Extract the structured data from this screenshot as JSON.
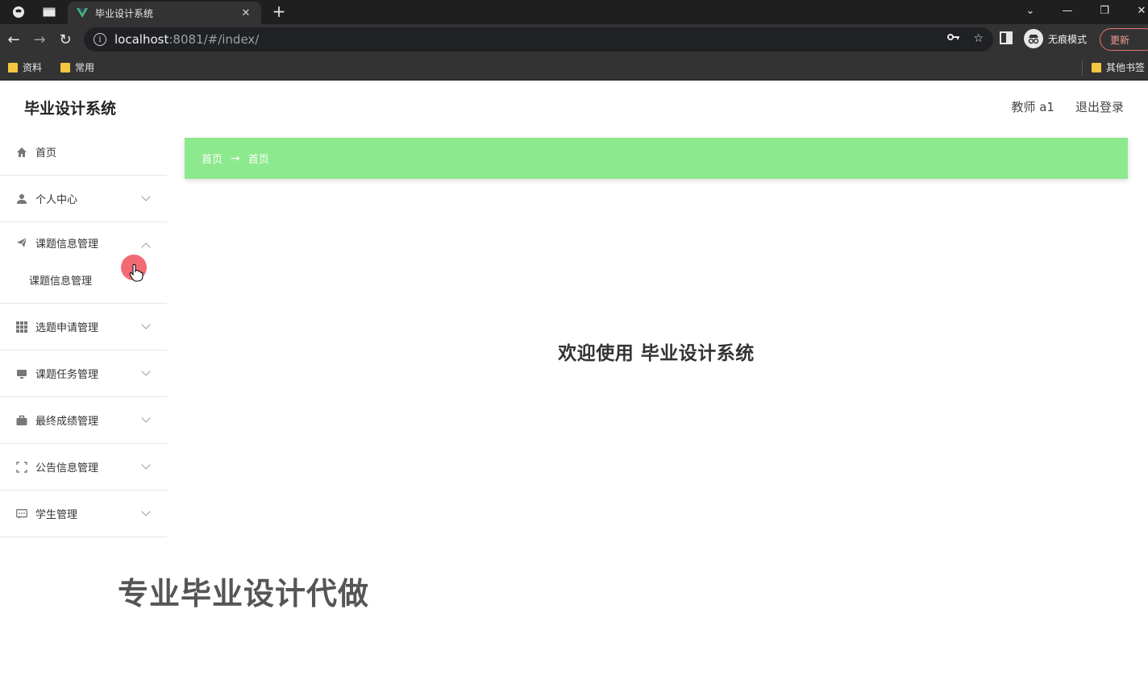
{
  "browser": {
    "tab_title": "毕业设计系统",
    "url_host": "localhost",
    "url_rest": ":8081/#/index/",
    "incognito_label": "无痕模式",
    "update_label": "更新",
    "bookmarks": [
      {
        "label": "资料"
      },
      {
        "label": "常用"
      }
    ],
    "other_bookmarks": "其他书签"
  },
  "app": {
    "title": "毕业设计系统",
    "user_label": "教师 a1",
    "logout_label": "退出登录"
  },
  "sidebar": {
    "items": [
      {
        "label": "首页",
        "icon": "home-icon"
      },
      {
        "label": "个人中心",
        "icon": "user-icon"
      },
      {
        "label": "课题信息管理",
        "icon": "paper-plane-icon",
        "expanded": true,
        "children": [
          {
            "label": "课题信息管理"
          }
        ]
      },
      {
        "label": "选题申请管理",
        "icon": "grid-icon"
      },
      {
        "label": "课题任务管理",
        "icon": "monitor-icon"
      },
      {
        "label": "最终成绩管理",
        "icon": "briefcase-icon"
      },
      {
        "label": "公告信息管理",
        "icon": "fullscreen-icon"
      },
      {
        "label": "学生管理",
        "icon": "chat-icon"
      }
    ]
  },
  "breadcrumb": {
    "items": [
      "首页",
      "首页"
    ],
    "separator": "→",
    "color": "#8de98d"
  },
  "main": {
    "welcome": "欢迎使用 毕业设计系统"
  },
  "overlay": {
    "watermark": "专业毕业设计代做"
  }
}
